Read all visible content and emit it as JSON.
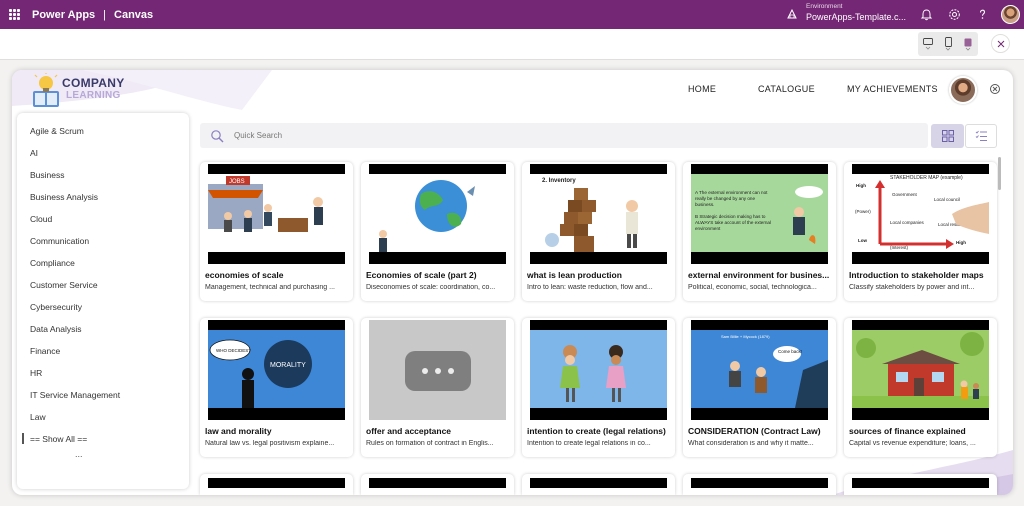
{
  "topbar": {
    "app_name": "Power Apps",
    "separator": "|",
    "app_mode": "Canvas",
    "environment_label": "Environment",
    "environment_name": "PowerApps-Template.c..."
  },
  "header": {
    "logo_line1": "COMPANY",
    "logo_line2": "LEARNING",
    "nav": [
      "HOME",
      "CATALOGUE",
      "MY ACHIEVEMENTS"
    ]
  },
  "sidebar": {
    "items": [
      "Agile & Scrum",
      "AI",
      "Business",
      "Business Analysis",
      "Cloud",
      "Communication",
      "Compliance",
      "Customer Service",
      "Cybersecurity",
      "Data Analysis",
      "Finance",
      "HR",
      "IT Service Management",
      "Law",
      "== Show All =="
    ],
    "more": "..."
  },
  "search": {
    "placeholder": "Quick Search"
  },
  "cards": [
    {
      "title": "economies of scale",
      "desc": "Management, technical and purchasing ..."
    },
    {
      "title": "Economies of scale (part 2)",
      "desc": "Diseconomies of scale: coordination, co..."
    },
    {
      "title": "what is lean production",
      "desc": "Intro to lean: waste reduction, flow and..."
    },
    {
      "title": "external environment for busines...",
      "desc": "Political, economic, social, technologica..."
    },
    {
      "title": "Introduction to stakeholder maps",
      "desc": "Classify stakeholders by power and int..."
    },
    {
      "title": "law and morality",
      "desc": "Natural law vs. legal positivism explaine..."
    },
    {
      "title": "offer and acceptance",
      "desc": "Rules on formation of contract in Englis..."
    },
    {
      "title": "intention to create (legal relations)",
      "desc": "Intention to create legal relations in co..."
    },
    {
      "title": "CONSIDERATION (Contract Law)",
      "desc": "What consideration is and why it matte..."
    },
    {
      "title": "sources of finance explained",
      "desc": "Capital vs revenue expenditure; loans, ..."
    }
  ],
  "thumb_text": {
    "jobs": "JOBS",
    "inventory": "2. Inventory",
    "env_a": "A The external environment can not really be changed by any one business.",
    "env_b": "B Strategic decision making has to ALWAYS take account of the external environment",
    "stake_title": "STAKEHOLDER MAP (example)",
    "stake_high": "High",
    "stake_power": "(Power)",
    "stake_low": "Low",
    "stake_interest": "(Interest)",
    "stake_high2": "High",
    "stake_gov": "Government",
    "stake_council": "Local council",
    "stake_companies": "Local companies",
    "stake_residents": "Local residents",
    "who_decides": "WHO DECIDES?",
    "morality": "MORALITY",
    "consideration_caption": "Sam Billie + Mycock (1879)",
    "come_back": "Come back!"
  },
  "colors": {
    "brand": "#742774",
    "accent_soft": "#d8d4e8"
  }
}
